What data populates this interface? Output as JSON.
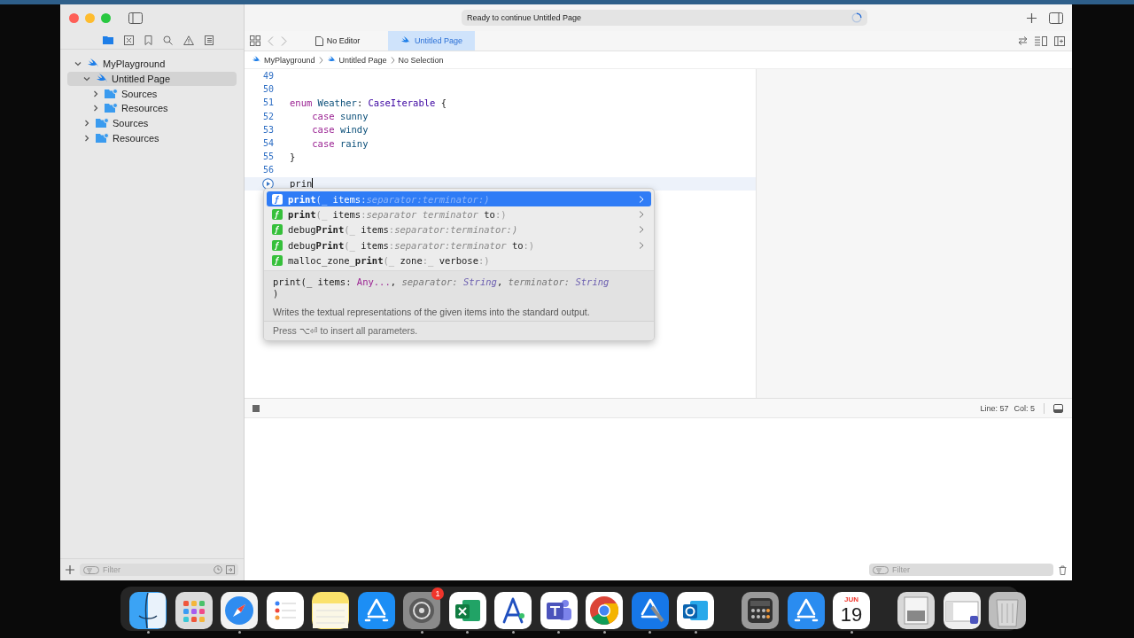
{
  "status": {
    "text": "Ready to continue Untitled Page"
  },
  "navigator_tree": [
    {
      "label": "MyPlayground",
      "kind": "swift",
      "expanded": true,
      "selected": false,
      "children": [
        {
          "label": "Untitled Page",
          "kind": "swift",
          "expanded": true,
          "selected": true,
          "children": [
            {
              "label": "Sources",
              "kind": "folder",
              "expanded": false,
              "selected": false
            },
            {
              "label": "Resources",
              "kind": "folder",
              "expanded": false,
              "selected": false
            }
          ]
        },
        {
          "label": "Sources",
          "kind": "folder",
          "expanded": false,
          "selected": false
        },
        {
          "label": "Resources",
          "kind": "folder",
          "expanded": false,
          "selected": false
        }
      ]
    }
  ],
  "navigator_filter": {
    "placeholder": "Filter"
  },
  "tabs": [
    {
      "label": "No Editor",
      "kind": "doc",
      "selected": false
    },
    {
      "label": "Untitled Page",
      "kind": "swift",
      "selected": true
    }
  ],
  "breadcrumb": [
    {
      "label": "MyPlayground",
      "kind": "swift"
    },
    {
      "label": "Untitled Page",
      "kind": "swift"
    },
    {
      "label": "No Selection",
      "kind": "none"
    }
  ],
  "code_lines": [
    {
      "number": "49",
      "kind": "number",
      "current": false
    },
    {
      "number": "50",
      "kind": "number",
      "current": false
    },
    {
      "number": "51",
      "kind": "number",
      "current": false,
      "tokens": [
        {
          "text": "enum",
          "kind": "keyword"
        },
        {
          "text": " Weather",
          "kind": "decl"
        },
        {
          "text": ": ",
          "kind": "plain"
        },
        {
          "text": "CaseIterable",
          "kind": "type"
        },
        {
          "text": " {",
          "kind": "plain"
        }
      ]
    },
    {
      "number": "52",
      "kind": "number",
      "current": false,
      "tokens": [
        {
          "text": "    case",
          "kind": "keyword"
        },
        {
          "text": " sunny",
          "kind": "decl"
        }
      ]
    },
    {
      "number": "53",
      "kind": "number",
      "current": false,
      "tokens": [
        {
          "text": "    case",
          "kind": "keyword"
        },
        {
          "text": " windy",
          "kind": "decl"
        }
      ]
    },
    {
      "number": "54",
      "kind": "number",
      "current": false,
      "tokens": [
        {
          "text": "    case",
          "kind": "keyword"
        },
        {
          "text": " rainy",
          "kind": "decl"
        }
      ]
    },
    {
      "number": "55",
      "kind": "number",
      "current": false,
      "tokens": [
        {
          "text": "}",
          "kind": "plain"
        }
      ]
    },
    {
      "number": "56",
      "kind": "number",
      "current": false
    },
    {
      "kind": "run",
      "current": true,
      "tokens": [
        {
          "text": "prin",
          "kind": "plain"
        }
      ]
    }
  ],
  "completions": [
    {
      "selected": true,
      "chevron": true,
      "parts": [
        {
          "text": "print",
          "kind": "match"
        },
        {
          "text": "(_ ",
          "kind": "punct"
        },
        {
          "text": "items",
          "kind": "label"
        },
        {
          "text": ":",
          "kind": "punct"
        },
        {
          "text": "separator:terminator:)",
          "kind": "param"
        }
      ]
    },
    {
      "selected": false,
      "chevron": true,
      "parts": [
        {
          "text": "print",
          "kind": "match"
        },
        {
          "text": "(_ ",
          "kind": "punct"
        },
        {
          "text": "items",
          "kind": "label"
        },
        {
          "text": ":",
          "kind": "punct"
        },
        {
          "text": "separator terminator",
          "kind": "param"
        },
        {
          "text": " to",
          "kind": "label"
        },
        {
          "text": ":)",
          "kind": "punct"
        }
      ]
    },
    {
      "selected": false,
      "chevron": true,
      "parts": [
        {
          "text": "debug",
          "kind": "label"
        },
        {
          "text": "Print",
          "kind": "match"
        },
        {
          "text": "(_ ",
          "kind": "punct"
        },
        {
          "text": "items",
          "kind": "label"
        },
        {
          "text": ":",
          "kind": "punct"
        },
        {
          "text": "separator:terminator:)",
          "kind": "param"
        }
      ]
    },
    {
      "selected": false,
      "chevron": true,
      "parts": [
        {
          "text": "debug",
          "kind": "label"
        },
        {
          "text": "Print",
          "kind": "match"
        },
        {
          "text": "(_ ",
          "kind": "punct"
        },
        {
          "text": "items",
          "kind": "label"
        },
        {
          "text": ":",
          "kind": "punct"
        },
        {
          "text": "separator:terminator",
          "kind": "param"
        },
        {
          "text": " to",
          "kind": "label"
        },
        {
          "text": ":)",
          "kind": "punct"
        }
      ]
    },
    {
      "selected": false,
      "chevron": false,
      "parts": [
        {
          "text": "malloc_zone_",
          "kind": "label"
        },
        {
          "text": "print",
          "kind": "match"
        },
        {
          "text": "(_ ",
          "kind": "punct"
        },
        {
          "text": "zone",
          "kind": "label"
        },
        {
          "text": ":_ ",
          "kind": "punct"
        },
        {
          "text": "verbose",
          "kind": "label"
        },
        {
          "text": ":)",
          "kind": "punct"
        }
      ]
    }
  ],
  "completion_doc": {
    "signature": [
      [
        {
          "text": "print(_ items: ",
          "kind": "plain"
        },
        {
          "text": "Any...",
          "kind": "type"
        },
        {
          "text": ", ",
          "kind": "plain"
        },
        {
          "text": "separator: ",
          "kind": "param"
        },
        {
          "text": "String",
          "kind": "ptype"
        },
        {
          "text": ", ",
          "kind": "plain"
        },
        {
          "text": "terminator: ",
          "kind": "param"
        },
        {
          "text": "String",
          "kind": "ptype"
        }
      ],
      [
        {
          "text": ")",
          "kind": "plain"
        }
      ]
    ],
    "summary": "Writes the textual representations of the given items into the standard output.",
    "hint": "Press ⌥⏎ to insert all parameters."
  },
  "position": {
    "line": "Line: 57",
    "col": "Col: 5"
  },
  "console_filter": {
    "placeholder": "Filter"
  },
  "dock": [
    {
      "kind": "finder",
      "running": true
    },
    {
      "kind": "launchpad",
      "running": false
    },
    {
      "kind": "safari",
      "running": true
    },
    {
      "kind": "reminders",
      "running": false
    },
    {
      "kind": "notes",
      "running": false
    },
    {
      "kind": "appstore",
      "running": false
    },
    {
      "kind": "settings",
      "running": true,
      "badge": "1"
    },
    {
      "kind": "excel",
      "running": true
    },
    {
      "kind": "instruments",
      "running": true
    },
    {
      "kind": "teams",
      "running": true
    },
    {
      "kind": "chrome",
      "running": true
    },
    {
      "kind": "xcode",
      "running": true
    },
    {
      "kind": "outlook",
      "running": true
    },
    {
      "kind": "divider"
    },
    {
      "kind": "calculator",
      "running": false
    },
    {
      "kind": "simulator",
      "running": false
    },
    {
      "kind": "calendar",
      "running": true,
      "month": "JUN",
      "day": "19"
    },
    {
      "kind": "divider"
    },
    {
      "kind": "document",
      "running": false
    },
    {
      "kind": "window",
      "running": false
    },
    {
      "kind": "trash",
      "running": false
    }
  ]
}
